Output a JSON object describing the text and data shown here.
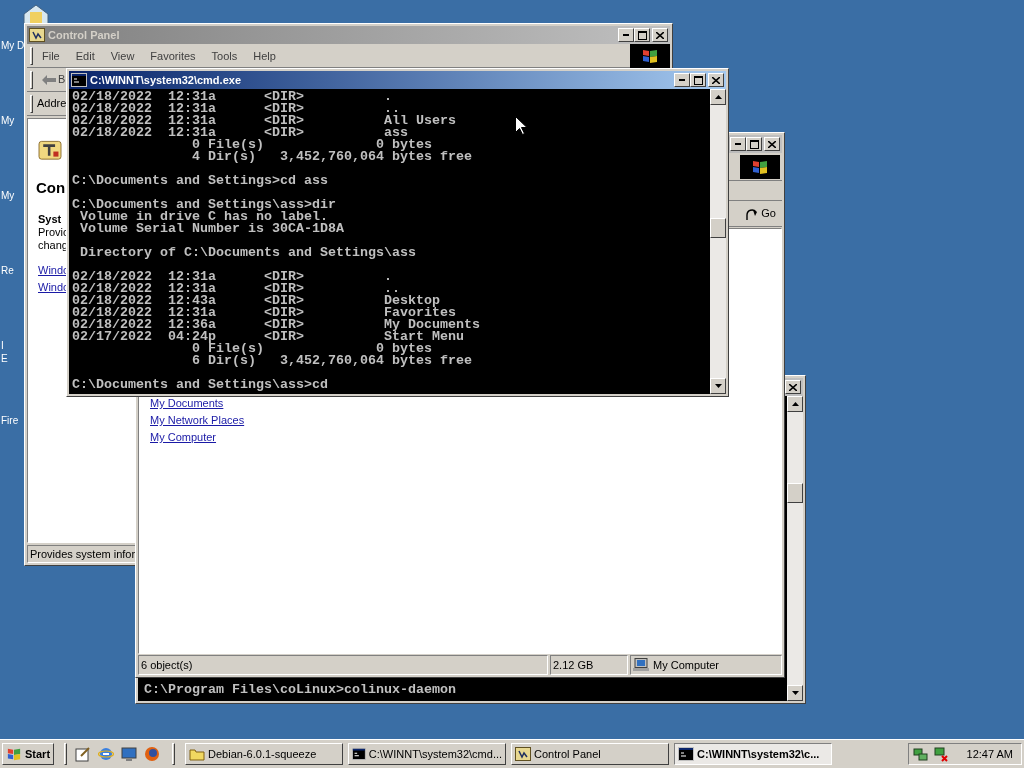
{
  "desktop": {
    "icons": [
      {
        "lines": [
          "My D"
        ]
      },
      {
        "lines": [
          "My"
        ]
      },
      {
        "lines": [
          "My"
        ]
      },
      {
        "lines": [
          "Re"
        ]
      },
      {
        "lines": [
          "I",
          "E"
        ]
      },
      {
        "lines": [
          "Fire"
        ]
      }
    ]
  },
  "control_panel": {
    "title": "Control Panel",
    "active": false,
    "menu": [
      "File",
      "Edit",
      "View",
      "Favorites",
      "Tools",
      "Help"
    ],
    "back_label": "B",
    "address_label": "Addre",
    "heading": "Con",
    "item_title": "Syst",
    "item_description": [
      "Provic",
      "chang"
    ],
    "links": [
      "Windc",
      "Windc"
    ],
    "status": "Provides system infor"
  },
  "explorer": {
    "active": false,
    "go_button": "Go",
    "links": [
      "My Documents",
      "My Network Places",
      "My Computer"
    ],
    "status": {
      "objects": "6 object(s)",
      "size": "2.12 GB",
      "zone": "My Computer"
    }
  },
  "background_console": {
    "active": false,
    "lines": [
      "C:\\Program Files\\coLinux>colinux-daemon"
    ]
  },
  "console": {
    "title": "C:\\WINNT\\system32\\cmd.exe",
    "active": true,
    "blocks": [
      [
        "02/18/2022  12:31a      <DIR>          .",
        "02/18/2022  12:31a      <DIR>          ..",
        "02/18/2022  12:31a      <DIR>          All Users",
        "02/18/2022  12:31a      <DIR>          ass",
        "               0 File(s)              0 bytes",
        "               4 Dir(s)   3,452,760,064 bytes free"
      ],
      [
        "C:\\Documents and Settings>cd ass"
      ],
      [
        "C:\\Documents and Settings\\ass>dir",
        " Volume in drive C has no label.",
        " Volume Serial Number is 30CA-1D8A"
      ],
      [
        " Directory of C:\\Documents and Settings\\ass"
      ],
      [
        "02/18/2022  12:31a      <DIR>          .",
        "02/18/2022  12:31a      <DIR>          ..",
        "02/18/2022  12:43a      <DIR>          Desktop",
        "02/18/2022  12:31a      <DIR>          Favorites",
        "02/18/2022  12:36a      <DIR>          My Documents",
        "02/17/2022  04:24p      <DIR>          Start Menu",
        "               0 File(s)              0 bytes",
        "               6 Dir(s)   3,452,760,064 bytes free"
      ],
      [
        "C:\\Documents and Settings\\ass>cd"
      ]
    ]
  },
  "taskbar": {
    "start": "Start",
    "tasks": [
      {
        "kind": "folder",
        "label": "Debian-6.0.1-squeeze",
        "selected": false
      },
      {
        "kind": "console",
        "label": "C:\\WINNT\\system32\\cmd...",
        "selected": false
      },
      {
        "kind": "control-panel",
        "label": "Control Panel",
        "selected": false
      },
      {
        "kind": "console",
        "label": "C:\\WINNT\\system32\\c...",
        "selected": true
      }
    ],
    "clock": "12:47 AM"
  }
}
